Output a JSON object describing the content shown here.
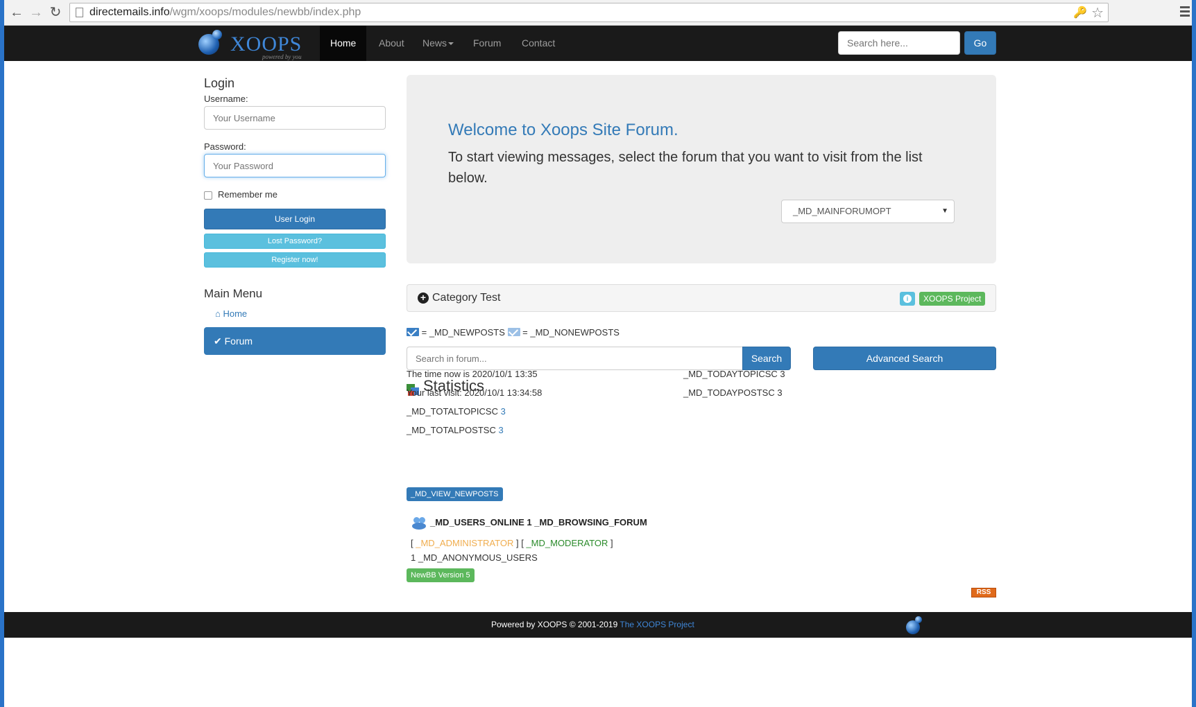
{
  "browser": {
    "url_host": "directemails.info",
    "url_path": "/wgm/xoops/modules/newbb/index.php"
  },
  "navbar": {
    "logo_text": "XOOPS",
    "logo_sub": "powered by you",
    "items": [
      {
        "label": "Home",
        "active": true
      },
      {
        "label": "About"
      },
      {
        "label": "News"
      },
      {
        "label": "Forum"
      },
      {
        "label": "Contact"
      }
    ],
    "search_placeholder": "Search here...",
    "go_label": "Go"
  },
  "login": {
    "title": "Login",
    "username_label": "Username:",
    "username_placeholder": "Your Username",
    "password_label": "Password:",
    "password_placeholder": "Your Password",
    "remember_label": "Remember me",
    "login_button": "User Login",
    "lost_password": "Lost Password?",
    "register": "Register now!"
  },
  "main_menu": {
    "title": "Main Menu",
    "home": "Home",
    "forum": "Forum"
  },
  "jumbotron": {
    "title": "Welcome to Xoops Site Forum.",
    "text": "To start viewing messages, select the forum that you want to visit from the list below.",
    "select_value": "_MD_MAINFORUMOPT"
  },
  "category": {
    "title": "Category Test",
    "label": "XOOPS Project"
  },
  "legend": {
    "new": "= _MD_NEWPOSTS",
    "old": "= _MD_NONEWPOSTS"
  },
  "forum_search": {
    "placeholder": "Search in forum...",
    "button": "Search",
    "advanced": "Advanced Search"
  },
  "statistics": {
    "title": "Statistics",
    "time_now": "The time now is 2020/10/1 13:35",
    "last_visit": "Your last visit: 2020/10/1 13:34:58",
    "total_topics_label": "_MD_TOTALTOPICSC",
    "total_topics_value": "3",
    "total_posts_label": "_MD_TOTALPOSTSC",
    "total_posts_value": "3",
    "today_topics": "_MD_TODAYTOPICSC 3",
    "today_posts": "_MD_TODAYPOSTSC 3",
    "view_newposts": "_MD_VIEW_NEWPOSTS"
  },
  "online": {
    "heading": "_MD_USERS_ONLINE 1 _MD_BROWSING_FORUM",
    "open1": "[",
    "administrator": "_MD_ADMINISTRATOR",
    "mid": "] [",
    "moderator": "_MD_MODERATOR",
    "close": "]",
    "anonymous": "1 _MD_ANONYMOUS_USERS",
    "version": "NewBB Version 5",
    "rss": "RSS"
  },
  "footer": {
    "text": "Powered by XOOPS © 2001-2019",
    "link": "The XOOPS Project"
  },
  "colors": {
    "primary": "#337ab7",
    "info": "#5bc0de",
    "success": "#5cb85c",
    "navbar": "#1a1a1a"
  }
}
